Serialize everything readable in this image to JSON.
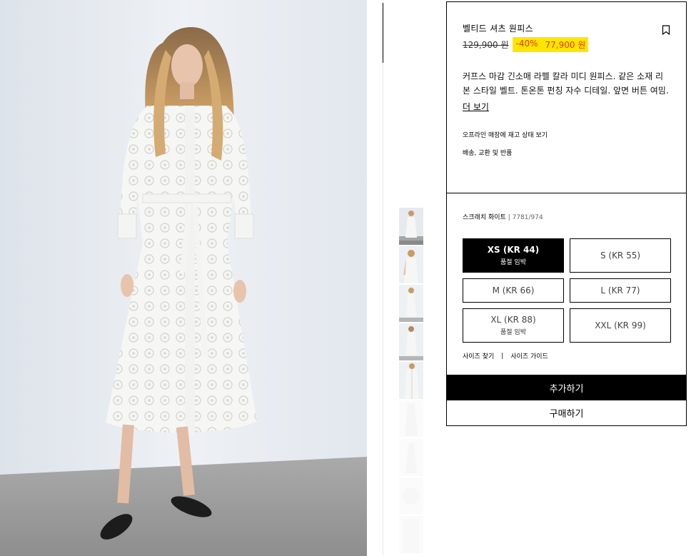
{
  "product": {
    "title": "벨티드 셔츠 원피스",
    "old_price": "129,900 원",
    "discount": "-40%",
    "new_price": "77,900 원",
    "description": "커프스 마감 긴소매 라펠 칼라 미디 원피스. 같은 소재 리본 스타일 벨트. 톤온톤 펀칭 자수 디테일. 앞면 버튼 여밈.",
    "more_label": "더 보기",
    "store_stock_label": "오프라인 매장에 재고 상태 보기",
    "shipping_label": "배송, 교환 및 반품"
  },
  "color": {
    "name": "스크래치 화이트",
    "code": "| 7781/974"
  },
  "sizes": [
    {
      "label": "XS (KR 44)",
      "note": "품절 임박"
    },
    {
      "label": "S (KR 55)",
      "note": ""
    },
    {
      "label": "M (KR 66)",
      "note": ""
    },
    {
      "label": "L (KR 77)",
      "note": ""
    },
    {
      "label": "XL (KR 88)",
      "note": "품절 임박"
    },
    {
      "label": "XXL (KR 99)",
      "note": ""
    }
  ],
  "size_links": {
    "find": "사이즈 찾기",
    "separator": "|",
    "guide": "사이즈 가이드"
  },
  "actions": {
    "add": "추가하기",
    "buy": "구매하기"
  },
  "icons": {
    "bookmark": "bookmark-icon"
  },
  "colors": {
    "sale_highlight": "#ffe600",
    "sale_text": "#e03a0f",
    "primary_button": "#000000"
  }
}
